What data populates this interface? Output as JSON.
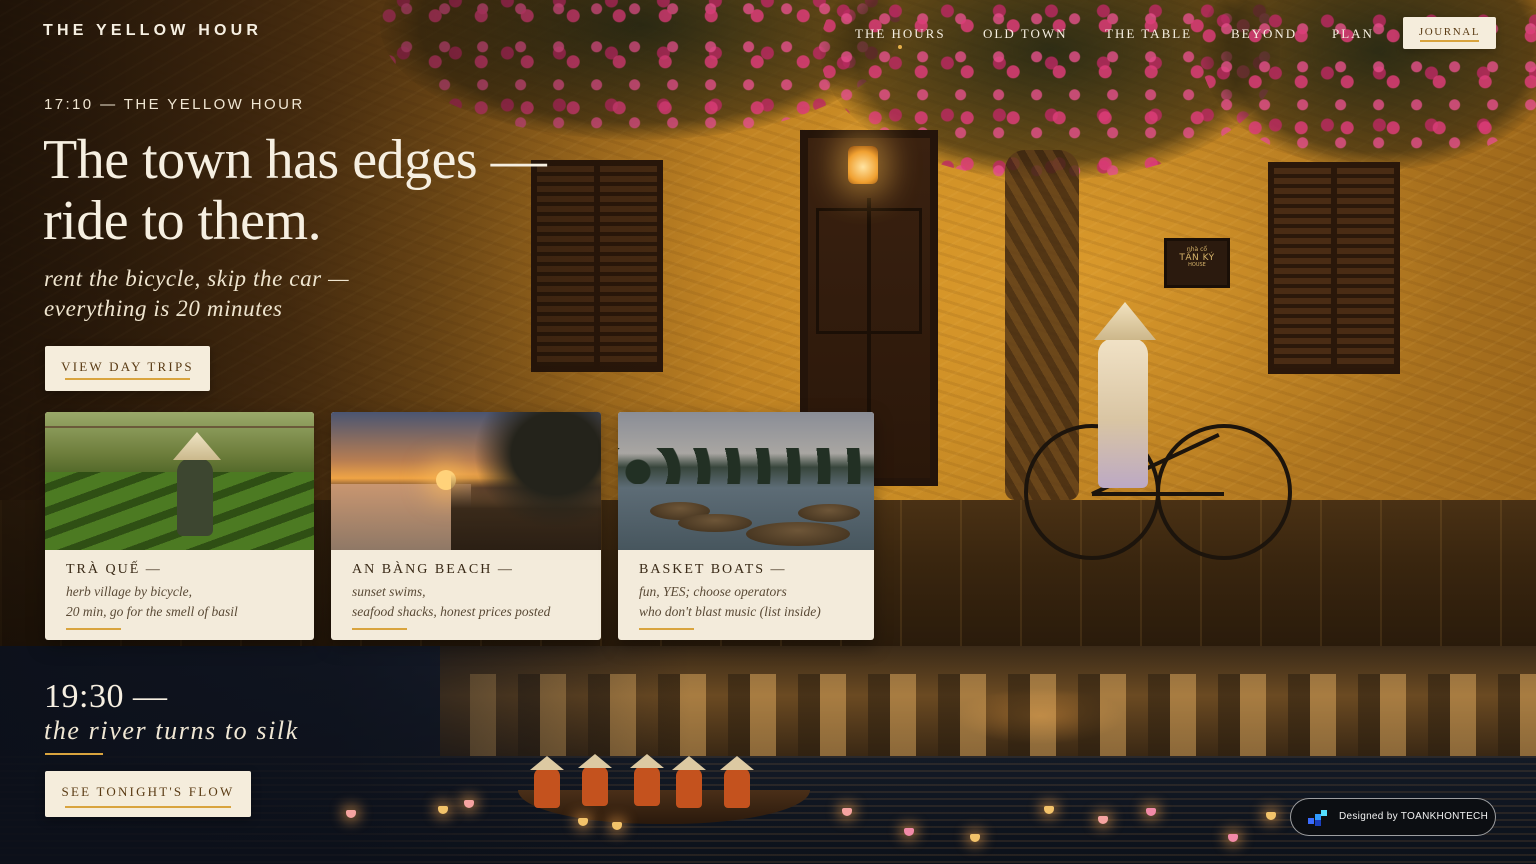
{
  "brand": {
    "name": "THE YELLOW HOUR"
  },
  "nav": {
    "items": [
      {
        "label": "THE HOURS",
        "active": true
      },
      {
        "label": "OLD TOWN",
        "active": false
      },
      {
        "label": "THE TABLE",
        "active": false
      },
      {
        "label": "BEYOND",
        "active": false
      },
      {
        "label": "PLAN",
        "active": false
      }
    ],
    "cta_label": "JOURNAL"
  },
  "hero": {
    "kicker": "17:10 — THE YELLOW HOUR",
    "headline_line1": "The town has edges —",
    "headline_line2": "ride to them.",
    "sub_line1": "rent the bicycle, skip the car —",
    "sub_line2": "everything is 20 minutes",
    "button_label": "VIEW DAY TRIPS",
    "plaque": {
      "line1": "nhà cổ",
      "line2": "TẤN KÝ",
      "line3": "HOUSE"
    }
  },
  "cards": [
    {
      "title": "TRÀ QUẾ —",
      "line1": "herb village by bicycle,",
      "line2": "20 min, go for the smell of basil",
      "image": "herb-field-photo"
    },
    {
      "title": "AN BÀNG BEACH —",
      "line1": "sunset swims,",
      "line2": "seafood shacks, honest prices posted",
      "image": "beach-sunset-photo"
    },
    {
      "title": "BASKET BOATS —",
      "line1": "fun, YES; choose operators",
      "line2": "who don't blast music (list inside)",
      "image": "basket-boats-photo"
    }
  ],
  "evening": {
    "time": "19:30 —",
    "line": "the river turns to silk",
    "button_label": "SEE TONIGHT'S FLOW"
  },
  "badge": {
    "label": "Designed by TOANKHONTECH"
  },
  "colors": {
    "accent_gold": "#d9a43e",
    "cream": "#f5eddc",
    "ink_brown": "#5a3b14",
    "night": "#141a26"
  }
}
